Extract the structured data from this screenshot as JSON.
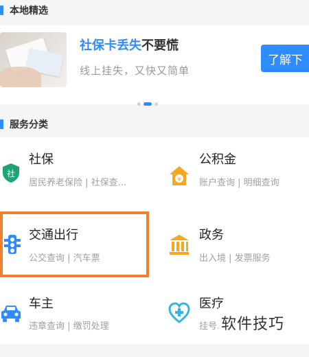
{
  "local_picks": {
    "section_title": "本地精选",
    "banner": {
      "title_highlight": "社保卡丢失",
      "title_rest": "不要慌",
      "subtitle": "线上挂失，又快又简单",
      "button_label": "了解下"
    }
  },
  "service_categories": {
    "section_title": "服务分类",
    "items": [
      {
        "name": "社保",
        "desc": "居民养老保险 | 社保查...",
        "icon": "shield-icon",
        "color": "#1ea374"
      },
      {
        "name": "公积金",
        "desc": "账户查询 | 明细查询",
        "icon": "house-coin-icon",
        "color": "#f5a623"
      },
      {
        "name": "交通出行",
        "desc": "公交查询 | 汽车票",
        "icon": "traffic-light-icon",
        "color": "#2f8cff"
      },
      {
        "name": "政务",
        "desc": "出入境 | 发票服务",
        "icon": "government-building-icon",
        "color": "#f5a623"
      },
      {
        "name": "车主",
        "desc": "违章查询 | 缴罚处理",
        "icon": "car-icon",
        "color": "#2f8cff"
      },
      {
        "name": "医疗",
        "desc": "挂号...",
        "icon": "medical-heart-icon",
        "color": "#2fb7e0"
      }
    ]
  },
  "watermark": "软件技巧",
  "colors": {
    "accent": "#2f8cff",
    "highlight_border": "#f07f2e"
  }
}
